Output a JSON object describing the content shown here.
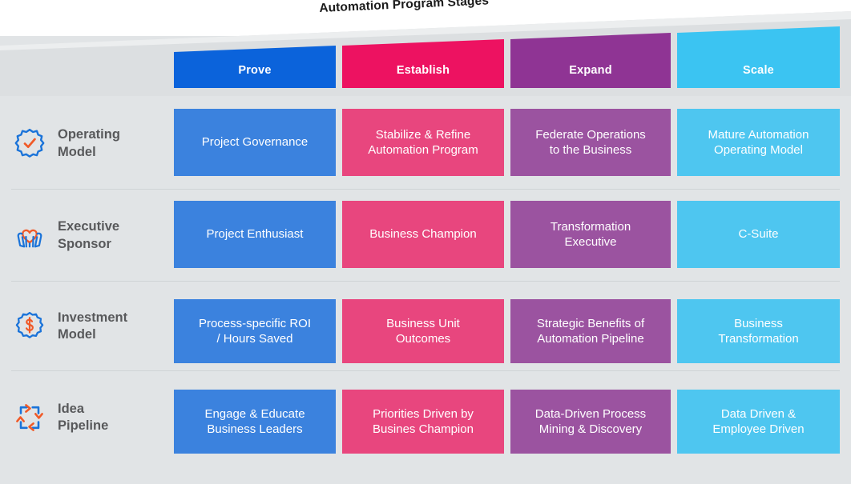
{
  "title": "Automation Program Stages",
  "colors": {
    "background": "#e1e4e6",
    "wedge_light": "#eceeef",
    "wedge_mid": "#dcdfe1",
    "divider": "#cfd4d6",
    "label_text": "#58595b",
    "icon_blue": "#1a73d9",
    "icon_orange": "#f05a28",
    "stage_prove_header": "#0b63db",
    "stage_establish_header": "#ed1261",
    "stage_expand_header": "#8f3494",
    "stage_scale_header": "#3bc4f2",
    "stage_prove_body": "#3b82de",
    "stage_establish_body": "#e8467e",
    "stage_expand_body": "#9b53a0",
    "stage_scale_body": "#4ec6f0"
  },
  "stages": [
    {
      "id": "prove",
      "label": "Prove"
    },
    {
      "id": "establish",
      "label": "Establish"
    },
    {
      "id": "expand",
      "label": "Expand"
    },
    {
      "id": "scale",
      "label": "Scale"
    }
  ],
  "rows": [
    {
      "id": "operating-model",
      "icon": "gear-check-icon",
      "label": "Operating\nModel",
      "cells": [
        "Project Governance",
        "Stabilize & Refine\nAutomation Program",
        "Federate Operations\nto the Business",
        "Mature Automation\nOperating Model"
      ]
    },
    {
      "id": "executive-sponsor",
      "icon": "hands-heart-icon",
      "label": "Executive\nSponsor",
      "cells": [
        "Project Enthusiast",
        "Business Champion",
        "Transformation\nExecutive",
        "C-Suite"
      ]
    },
    {
      "id": "investment-model",
      "icon": "dollar-badge-icon",
      "label": "Investment\nModel",
      "cells": [
        "Process-specific ROI\n/ Hours Saved",
        "Business Unit\nOutcomes",
        "Strategic Benefits of\nAutomation Pipeline",
        "Business\nTransformation"
      ]
    },
    {
      "id": "idea-pipeline",
      "icon": "pipeline-cycle-icon",
      "label": "Idea\nPipeline",
      "cells": [
        "Engage & Educate\nBusiness Leaders",
        "Priorities Driven by\nBusines Champion",
        "Data-Driven Process\nMining & Discovery",
        "Data Driven &\nEmployee Driven"
      ]
    }
  ]
}
